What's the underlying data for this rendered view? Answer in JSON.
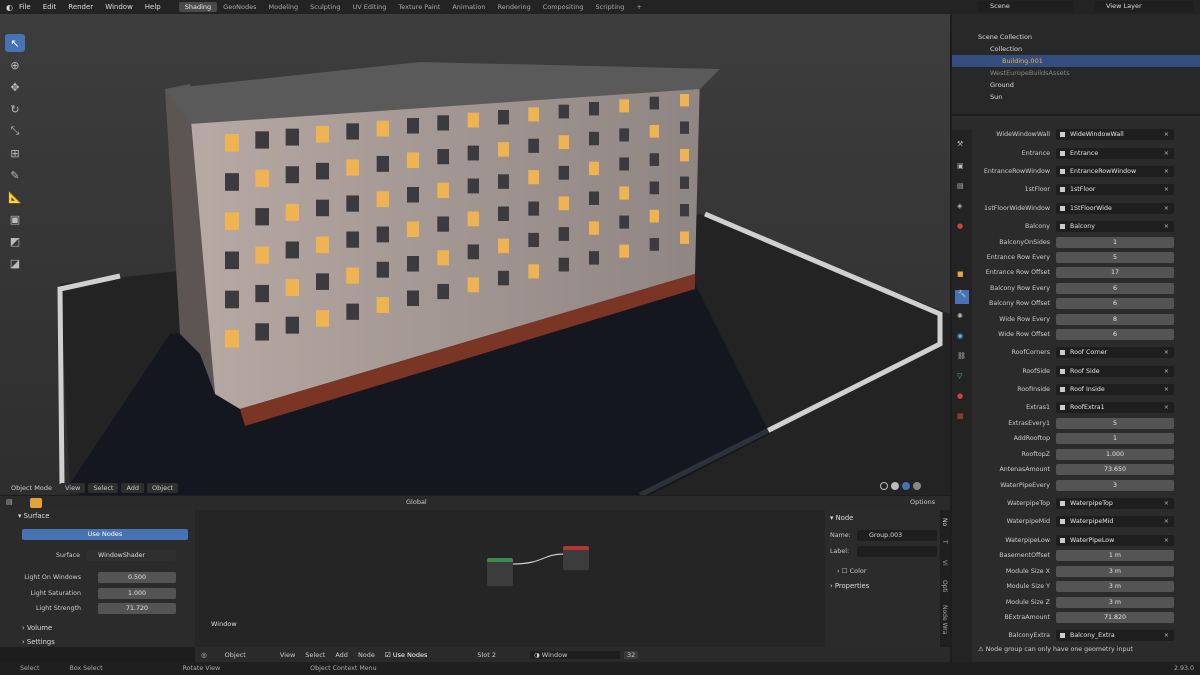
{
  "topbar": {
    "menus": [
      "File",
      "Edit",
      "Render",
      "Window",
      "Help"
    ],
    "workspaces": [
      "Shading",
      "GeoNodes",
      "Modeling",
      "Sculpting",
      "UV Editing",
      "Texture Paint",
      "Animation",
      "Rendering",
      "Compositing",
      "Scripting"
    ],
    "scene": "Scene",
    "view_layer": "View Layer"
  },
  "viewport": {
    "mode": "Object Mode",
    "menus": [
      "View",
      "Select",
      "Add",
      "Object"
    ]
  },
  "editor_header": {
    "orientation": "Global",
    "options": "Options"
  },
  "outliner": {
    "items": [
      {
        "label": "Scene Collection"
      },
      {
        "label": "Collection"
      },
      {
        "label": "Building.001"
      },
      {
        "label": "WestEuropeBuildsAssets"
      },
      {
        "label": "Ground"
      },
      {
        "label": "Sun"
      }
    ]
  },
  "properties": {
    "rows": [
      {
        "label": "WideWindowWall",
        "value": "WideWindowWall",
        "kind": "obj"
      },
      {
        "label": "Entrance",
        "value": "Entrance",
        "kind": "obj"
      },
      {
        "label": "EntranceRowWindow",
        "value": "EntranceRowWindow",
        "kind": "obj"
      },
      {
        "label": "1stFloor",
        "value": "1stFloor",
        "kind": "obj"
      },
      {
        "label": "1stFloorWideWindow",
        "value": "1StFloorWide",
        "kind": "obj"
      },
      {
        "label": "Balcony",
        "value": "Balcony",
        "kind": "obj"
      },
      {
        "label": "BalconyOnSides",
        "value": "1",
        "kind": "num"
      },
      {
        "label": "Entrance Row Every",
        "value": "5",
        "kind": "num"
      },
      {
        "label": "Entrance Row Offset",
        "value": "17",
        "kind": "num"
      },
      {
        "label": "Balcony Row Every",
        "value": "6",
        "kind": "num"
      },
      {
        "label": "Balcony Row Offset",
        "value": "6",
        "kind": "num"
      },
      {
        "label": "Wide Row Every",
        "value": "8",
        "kind": "num"
      },
      {
        "label": "Wide Row Offset",
        "value": "6",
        "kind": "num"
      },
      {
        "label": "RoofCorners",
        "value": "Roof Corner",
        "kind": "obj"
      },
      {
        "label": "RoofSide",
        "value": "Roof Side",
        "kind": "obj"
      },
      {
        "label": "RoofInside",
        "value": "Roof Inside",
        "kind": "obj"
      },
      {
        "label": "Extras1",
        "value": "RoofExtra1",
        "kind": "obj"
      },
      {
        "label": "ExtrasEvery1",
        "value": "5",
        "kind": "num"
      },
      {
        "label": "AddRooftop",
        "value": "1",
        "kind": "num"
      },
      {
        "label": "RooftopZ",
        "value": "1.000",
        "kind": "num"
      },
      {
        "label": "AntenasAmount",
        "value": "73.650",
        "kind": "num"
      },
      {
        "label": "WaterPipeEvery",
        "value": "3",
        "kind": "num"
      },
      {
        "label": "WaterpipeTop",
        "value": "WaterpipeTop",
        "kind": "obj"
      },
      {
        "label": "WaterpipeMid",
        "value": "WaterpipeMid",
        "kind": "obj"
      },
      {
        "label": "WaterpipeLow",
        "value": "WaterPipeLow",
        "kind": "obj"
      },
      {
        "label": "BasementOffset",
        "value": "1 m",
        "kind": "num"
      },
      {
        "label": "Module Size X",
        "value": "3 m",
        "kind": "num"
      },
      {
        "label": "Module Size Y",
        "value": "3 m",
        "kind": "num"
      },
      {
        "label": "Module Size Z",
        "value": "3 m",
        "kind": "num"
      },
      {
        "label": "BExtraAmount",
        "value": "71.820",
        "kind": "num"
      },
      {
        "label": "BalconyExtra",
        "value": "Balcony_Extra",
        "kind": "obj"
      }
    ],
    "info": "Node group can only have one geometry input"
  },
  "material": {
    "surface_header": "Surface",
    "use_nodes": "Use Nodes",
    "surface_label": "Surface",
    "surface_value": "WindowShader",
    "light_on_windows": "Light On Windows",
    "light_on_windows_value": "0.500",
    "light_saturation": "Light Saturation",
    "light_saturation_value": "1.000",
    "light_strength": "Light Strength",
    "light_strength_value": "71.720",
    "volume": "Volume",
    "settings": "Settings"
  },
  "node_panel": {
    "header": "Node",
    "name_label": "Name:",
    "name_value": "Group.003",
    "label_label": "Label:",
    "color": "Color",
    "properties": "Properties",
    "tabs": [
      "No",
      "T",
      "Vi",
      "Opti",
      "Node Wra"
    ]
  },
  "node_editor": {
    "frame_label": "Window",
    "menus": [
      "Object",
      "View",
      "Select",
      "Add",
      "Node"
    ],
    "use_nodes": "Use Nodes",
    "slot": "Slot 2",
    "material": "Window",
    "users": "32"
  },
  "statusbar": {
    "items": [
      "Select",
      "Box Select",
      "Rotate View",
      "Object Context Menu"
    ],
    "version": "2.93.0"
  }
}
